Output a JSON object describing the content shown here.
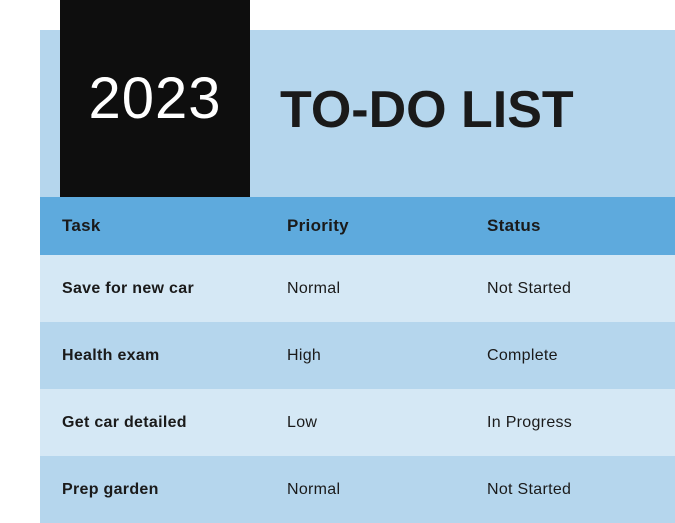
{
  "header": {
    "year": "2023",
    "title": "TO-DO LIST"
  },
  "table": {
    "columns": {
      "task": "Task",
      "priority": "Priority",
      "status": "Status"
    },
    "rows": [
      {
        "task": "Save for new car",
        "priority": "Normal",
        "status": "Not Started"
      },
      {
        "task": "Health exam",
        "priority": "High",
        "status": "Complete"
      },
      {
        "task": "Get car detailed",
        "priority": "Low",
        "status": "In Progress"
      },
      {
        "task": "Prep garden",
        "priority": "Normal",
        "status": "Not Started"
      }
    ]
  }
}
